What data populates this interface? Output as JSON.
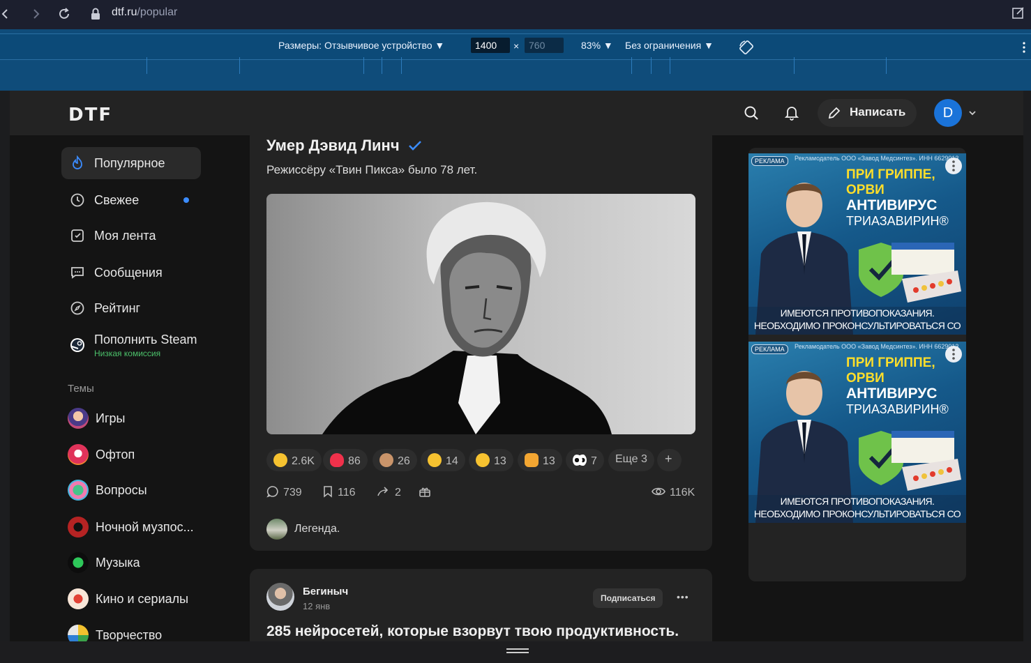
{
  "browser": {
    "url_host": "dtf.ru",
    "url_path": "/popular"
  },
  "devtools": {
    "dimensions_label": "Размеры: Отзывчивое устройство ▼",
    "width": "1400",
    "height_placeholder": "760",
    "times": "×",
    "zoom": "83% ▼",
    "throttle": "Без ограничения ▼"
  },
  "header": {
    "logo": "DTF",
    "write_label": "Написать",
    "avatar_letter": "D"
  },
  "sidebar": {
    "items": [
      {
        "label": "Популярное"
      },
      {
        "label": "Свежее"
      },
      {
        "label": "Моя лента"
      },
      {
        "label": "Сообщения"
      },
      {
        "label": "Рейтинг"
      },
      {
        "label": "Пополнить Steam",
        "sub": "Низкая комиссия"
      }
    ],
    "topics_heading": "Темы",
    "topics": [
      {
        "label": "Игры"
      },
      {
        "label": "Офтоп"
      },
      {
        "label": "Вопросы"
      },
      {
        "label": "Ночной музпос..."
      },
      {
        "label": "Музыка"
      },
      {
        "label": "Кино и сериалы"
      },
      {
        "label": "Творчество"
      }
    ]
  },
  "post1": {
    "title": "Умер Дэвид Линч",
    "subtitle": "Режиссёру «Твин Пикса» было 78 лет.",
    "reactions": [
      {
        "count": "2.6K"
      },
      {
        "count": "86"
      },
      {
        "count": "26"
      },
      {
        "count": "14"
      },
      {
        "count": "13"
      },
      {
        "count": "13"
      },
      {
        "count": "7"
      }
    ],
    "more_reactions": "Еще 3",
    "add_reaction": "+",
    "comments": "739",
    "bookmarks": "116",
    "reposts": "2",
    "views": "116K",
    "top_comment": "Легенда."
  },
  "post2": {
    "author": "Бегиныч",
    "date": "12 янв",
    "subscribe_label": "Подписаться",
    "more": "•••",
    "title": "285 нейросетей, которые взорвут твою продуктивность."
  },
  "ad": {
    "label": "РЕКЛАМА",
    "advertiser": "Рекламодатель ООО «Завод Медсинтез». ИНН 6629013",
    "line1": "ПРИ ГРИППЕ,",
    "line2": "ОРВИ",
    "line3": "АНТИВИРУС",
    "line4": "ТРИАЗАВИРИН®",
    "warning": "ИМЕЮТСЯ ПРОТИВОПОКАЗАНИЯ. НЕОБХОДИМО ПРОКОНСУЛЬТИРОВАТЬСЯ СО СПЕЦИАЛИСТОМ"
  }
}
